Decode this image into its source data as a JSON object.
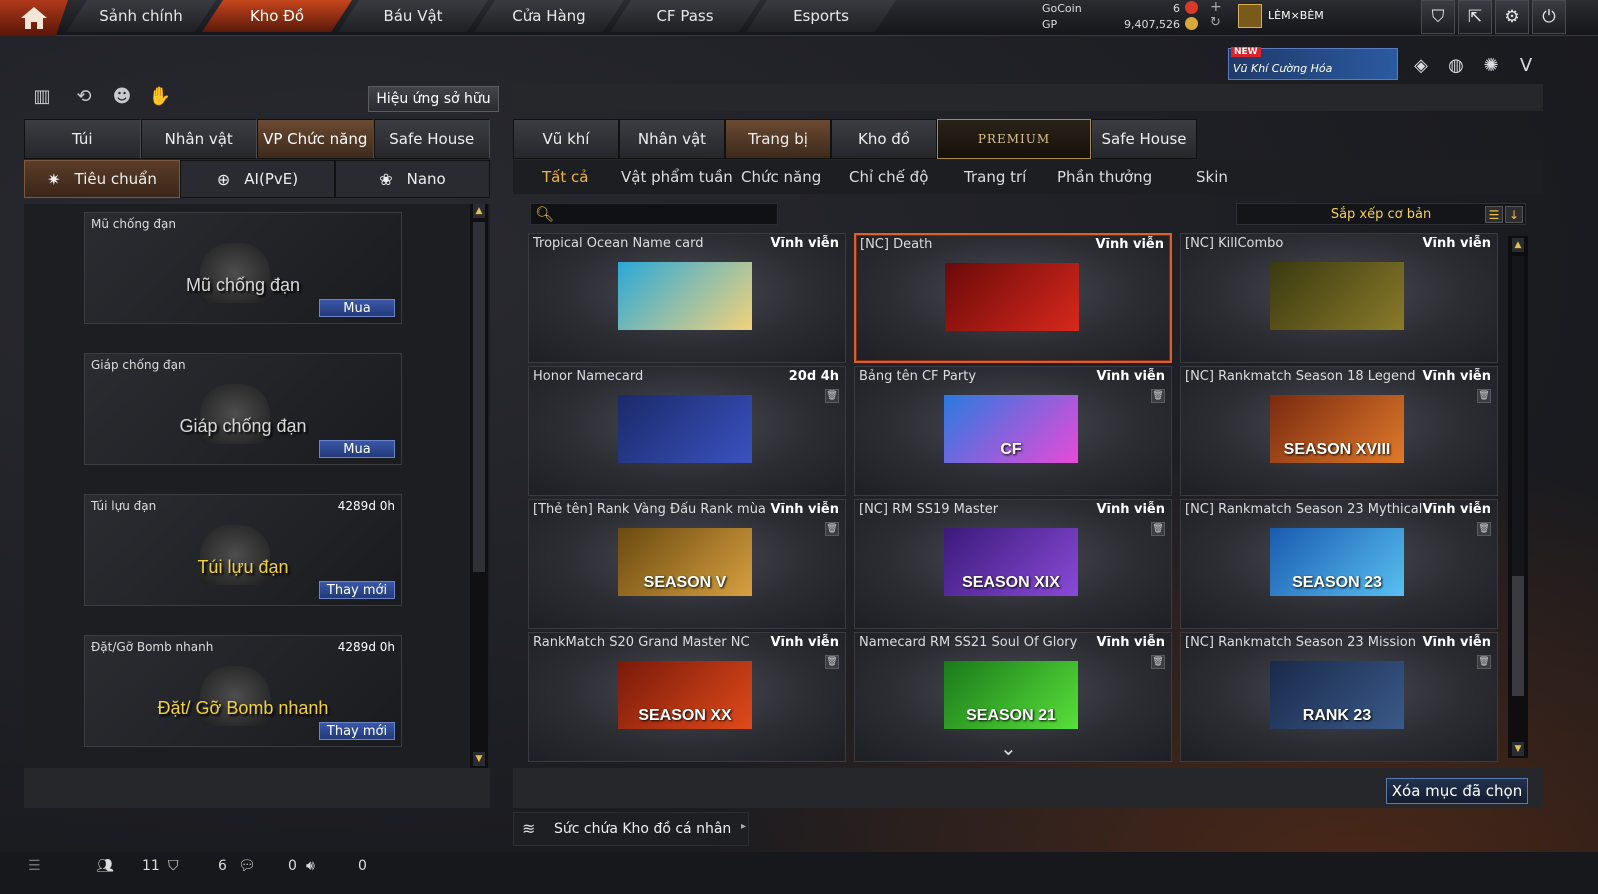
{
  "topnav": {
    "tabs": [
      "Sảnh chính",
      "Kho Đồ",
      "Báu Vật",
      "Cửa Hàng",
      "CF Pass",
      "Esports"
    ],
    "active_index": 1
  },
  "currency": {
    "gocoin_label": "GoCoin",
    "gocoin_value": "6",
    "gp_label": "GP",
    "gp_value": "9,407,526"
  },
  "player": {
    "name": "LÈM×BÈM"
  },
  "promo": {
    "badge": "NEW",
    "text": "Vũ Khí Cường Hóa"
  },
  "left": {
    "effect_button": "Hiệu ứng sở hữu",
    "tabs": [
      "Túi",
      "Nhân vật",
      "VP Chức năng",
      "Safe House"
    ],
    "active_tab": 2,
    "subtabs": [
      "Tiêu chuẩn",
      "AI(PvE)",
      "Nano"
    ],
    "active_subtab": 0,
    "items": [
      {
        "name": "Mũ chống đạn",
        "duration": "",
        "art_text": "Mũ chống đạn",
        "action": "Mua",
        "color": "#d8d8d8"
      },
      {
        "name": "Giáp chống đạn",
        "duration": "",
        "art_text": "Giáp chống đạn",
        "action": "Mua",
        "color": "#d8d8d8"
      },
      {
        "name": "Túi lựu đạn",
        "duration": "4289d 0h",
        "art_text": "Túi lựu đạn",
        "action": "Thay mới",
        "color": "#f2d23a"
      },
      {
        "name": "Đặt/Gỡ Bomb nhanh",
        "duration": "4289d 0h",
        "art_text": "Đặt/ Gỡ Bomb nhanh",
        "action": "Thay mới",
        "color": "#f2d23a"
      }
    ]
  },
  "right": {
    "tabs": [
      "Vũ khí",
      "Nhân vật",
      "Trang bị",
      "Kho đồ",
      "PREMIUM",
      "Safe House"
    ],
    "active_tab": 2,
    "filters": [
      "Tất cả",
      "Vật phẩm tuần",
      "Chức năng",
      "Chỉ chế độ",
      "Trang trí",
      "Phần thưởng",
      "Skin"
    ],
    "active_filter": 0,
    "search_placeholder": "",
    "sort_label": "Sắp xếp cơ bản",
    "delete_button": "Xóa mục đã chọn",
    "capacity_label": "Sức chứa Kho đồ cá nhân",
    "items": [
      {
        "name": "Tropical Ocean Name card",
        "duration": "Vĩnh viễn",
        "art": "",
        "colors": [
          "#2aa8d8",
          "#f3d27a"
        ]
      },
      {
        "name": "[NC] Death",
        "duration": "Vĩnh viễn",
        "art": "",
        "colors": [
          "#6a0a0a",
          "#d8281c"
        ],
        "selected": true
      },
      {
        "name": "[NC] KillCombo",
        "duration": "Vĩnh viễn",
        "art": "",
        "colors": [
          "#3a3a10",
          "#8a7a2a"
        ]
      },
      {
        "name": "Honor Namecard",
        "duration": "20d 4h",
        "art": "",
        "colors": [
          "#1a2a6a",
          "#3a52c0"
        ]
      },
      {
        "name": "Bảng tên CF Party",
        "duration": "Vĩnh viễn",
        "art": "CF",
        "colors": [
          "#2a7ae0",
          "#e84ad8"
        ]
      },
      {
        "name": "[NC] Rankmatch Season 18 Legend",
        "duration": "Vĩnh viễn",
        "art": "SEASON XVIII",
        "colors": [
          "#7a2a10",
          "#e07a2a"
        ]
      },
      {
        "name": "[Thẻ tên] Rank Vàng Đấu Rank mùa",
        "duration": "Vĩnh viễn",
        "art": "SEASON V",
        "colors": [
          "#6a4a10",
          "#d8a040"
        ]
      },
      {
        "name": "[NC] RM SS19 Master",
        "duration": "Vĩnh viễn",
        "art": "SEASON XIX",
        "colors": [
          "#3a1a7a",
          "#8a4ad8"
        ]
      },
      {
        "name": "[NC] Rankmatch Season 23 Mythical",
        "duration": "Vĩnh viễn",
        "art": "SEASON 23",
        "colors": [
          "#1a5ab0",
          "#58c0f0"
        ]
      },
      {
        "name": "RankMatch S20 Grand Master NC",
        "duration": "Vĩnh viễn",
        "art": "SEASON XX",
        "colors": [
          "#7a1a0a",
          "#e04a1a"
        ]
      },
      {
        "name": "Namecard RM SS21 Soul Of Glory",
        "duration": "Vĩnh viễn",
        "art": "SEASON 21",
        "colors": [
          "#1a7a1a",
          "#58e03a"
        ]
      },
      {
        "name": "[NC] Rankmatch Season 23 Mission",
        "duration": "Vĩnh viễn",
        "art": "RANK 23",
        "colors": [
          "#1a2a4a",
          "#3a5a8a"
        ]
      }
    ]
  },
  "bottom": {
    "count1": "11",
    "count2": "6",
    "count3": "0",
    "count4": "0"
  }
}
